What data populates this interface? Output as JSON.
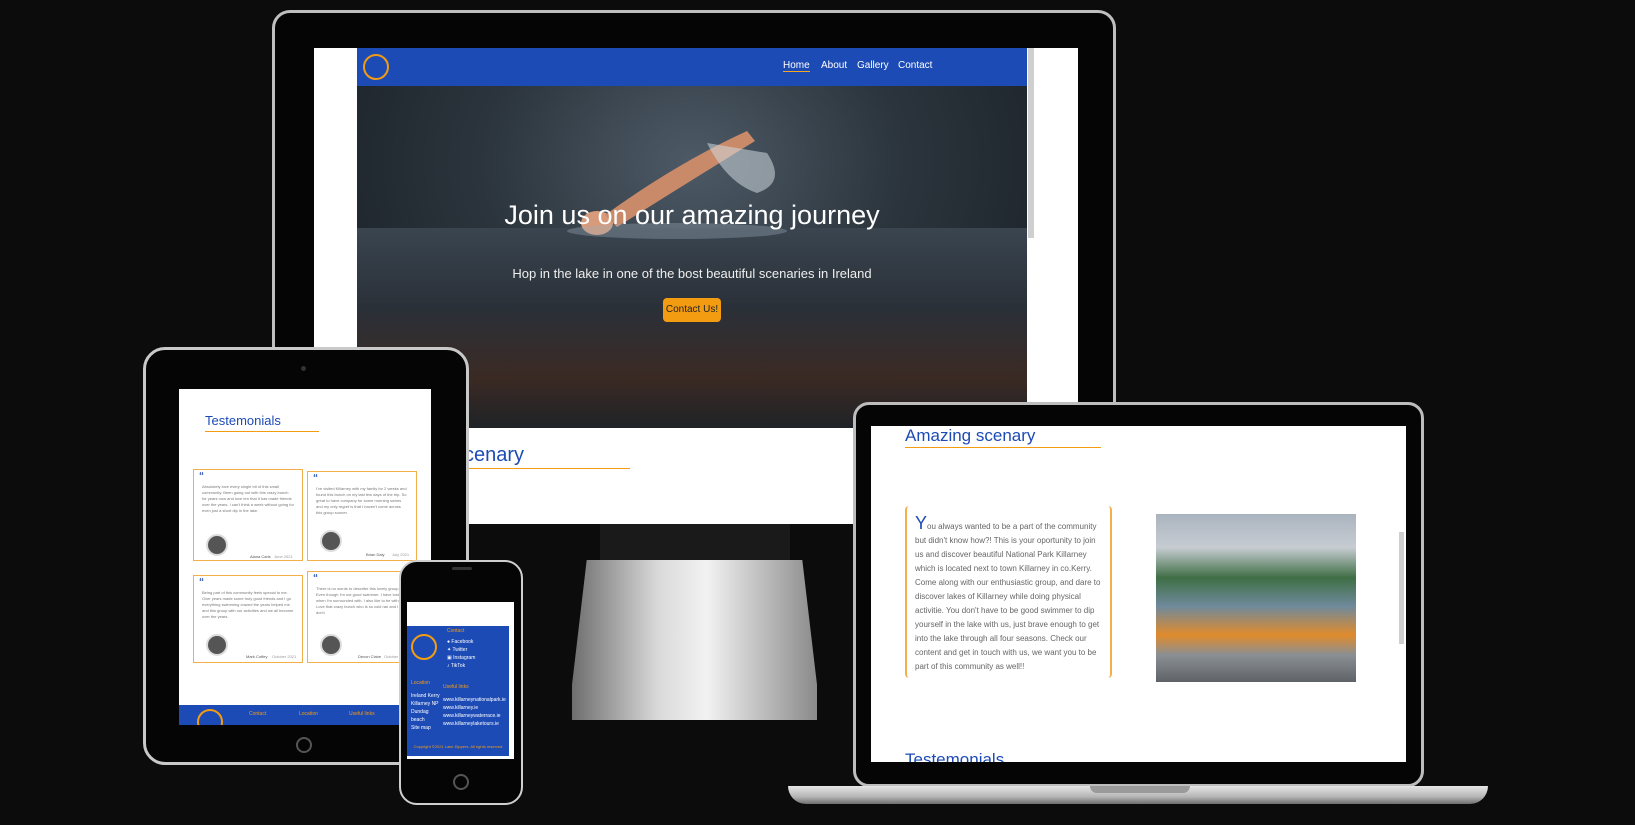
{
  "desktop": {
    "nav": {
      "links": [
        {
          "label": "Home",
          "active": true
        },
        {
          "label": "About"
        },
        {
          "label": "Gallery"
        },
        {
          "label": "Contact"
        }
      ]
    },
    "hero": {
      "title": "Join us on our amazing journey",
      "subtitle": "Hop in the lake in one of the bost beautiful scenaries in Ireland",
      "cta": "Contact Us!"
    },
    "section_heading_partial": "scenary"
  },
  "tablet": {
    "heading": "Testemonials",
    "testimonials": [
      {
        "text": "Absolutely love every single bit of this small community. Been going out with this crazy bunch for years now and love ten that it has made friends over the years. I can't think a week without going for even just a short dip in the lake.",
        "author": "Alana Carls",
        "date": "June 2021"
      },
      {
        "text": "I've visited Killarney with my family for 2 weeks and found this bunch on my last few days of the trip. So great to have company for some morning swims and my only regret is that I haven't come across this group sooner.",
        "author": "Brian Daly",
        "date": "July 2021"
      },
      {
        "text": "Being part of this community feels special to me. Over years made some truly good friends and I go everything swimming crazed the years helped me and this group with our activities and we all become over the years.",
        "author": "Mark Coffey",
        "date": "October 2021"
      },
      {
        "text": "There is no words to describe this lovely group. Even though I'm not good swimmer. I have lost fear when I'm surrounded with. I also like to be with. Love that crazy bunch who is so cold ran and I don't.",
        "author": "Devon Claire",
        "date": "October"
      }
    ],
    "footer": {
      "contact": "Contact",
      "location": "Location",
      "useful": "Useful links"
    }
  },
  "phone": {
    "contact_heading": "Contact",
    "social": [
      "Facebook",
      "Twitter",
      "Instagram",
      "TikTok"
    ],
    "location_heading": "Location",
    "locations": [
      "Ireland Kerry",
      "Killarney NP",
      "Dundag",
      "beach",
      "Site map"
    ],
    "links_heading": "Useful links",
    "links": [
      "www.killarneynationalpark.ie",
      "www.killarney.ie",
      "www.killarneywaterrace.ie",
      "www.killarneylaketours.ie"
    ],
    "copyright": "Copyright ©2021 Lake Dippers. All rights reserved"
  },
  "laptop": {
    "heading": "Amazing scenary",
    "dropcap": "Y",
    "paragraph": "ou always wanted to be a part of the community but didn't know how?! This is your oportunity to join us and discover beautiful National Park Killarney which is located next to town Killarney in co.Kerry. Come along with our enthusiastic group, and dare to discover lakes of Killarney while doing physical activitie. You don't have to be good swimmer to dip yourself in the lake with us, just brave enough to get into the lake through all four seasons. Check our content and get in touch with us, we want you to be part of this community as well!!",
    "next_heading": "Testemonials"
  }
}
